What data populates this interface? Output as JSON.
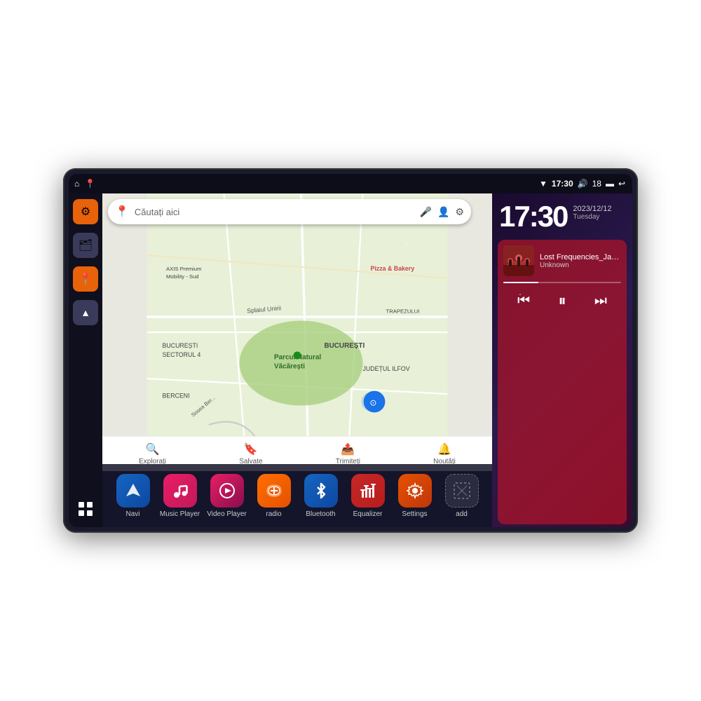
{
  "device": {
    "status_bar": {
      "wifi_icon": "▼",
      "time": "17:30",
      "volume_icon": "🔊",
      "battery_level": "18",
      "battery_icon": "🔋",
      "back_icon": "↩"
    },
    "sidebar": {
      "items": [
        {
          "id": "settings",
          "icon": "⚙",
          "label": "Settings",
          "color": "orange"
        },
        {
          "id": "files",
          "icon": "🗂",
          "label": "Files",
          "color": "gray"
        },
        {
          "id": "maps",
          "icon": "📍",
          "label": "Maps",
          "color": "orange"
        },
        {
          "id": "navigation",
          "icon": "▲",
          "label": "Navigation",
          "color": "gray"
        },
        {
          "id": "grid",
          "icon": "⋮⋮⋮",
          "label": "Grid",
          "color": "gray"
        }
      ]
    },
    "map": {
      "search_placeholder": "Căutați aici",
      "bottom_nav": [
        {
          "icon": "🔍",
          "label": "Explorați"
        },
        {
          "icon": "🔖",
          "label": "Salvate"
        },
        {
          "icon": "📤",
          "label": "Trimiteți"
        },
        {
          "icon": "🔔",
          "label": "Noutăți"
        }
      ],
      "places": [
        "AXIS Premium Mobility - Sud",
        "Parcul Natural Văcărești",
        "Pizza & Bakery",
        "BUCUREȘTI SECTORUL 4",
        "BERCENI",
        "BUCUREȘTI",
        "JUDEȚUL ILFOV",
        "TRAPEZULUI"
      ]
    },
    "clock": {
      "time": "17:30",
      "date": "2023/12/12",
      "day": "Tuesday"
    },
    "music": {
      "track_title": "Lost Frequencies_Janie...",
      "artist": "Unknown",
      "controls": {
        "prev": "⏮",
        "play_pause": "⏸",
        "next": "⏭"
      }
    },
    "apps": [
      {
        "id": "navi",
        "icon": "▲",
        "label": "Navi",
        "color_class": "icon-navi"
      },
      {
        "id": "music-player",
        "icon": "♪",
        "label": "Music Player",
        "color_class": "icon-music"
      },
      {
        "id": "video-player",
        "icon": "▶",
        "label": "Video Player",
        "color_class": "icon-video"
      },
      {
        "id": "radio",
        "icon": "📻",
        "label": "radio",
        "color_class": "icon-radio"
      },
      {
        "id": "bluetooth",
        "icon": "⚡",
        "label": "Bluetooth",
        "color_class": "icon-bluetooth"
      },
      {
        "id": "equalizer",
        "icon": "🎛",
        "label": "Equalizer",
        "color_class": "icon-equalizer"
      },
      {
        "id": "settings",
        "icon": "⚙",
        "label": "Settings",
        "color_class": "icon-settings"
      },
      {
        "id": "add",
        "icon": "+",
        "label": "add",
        "color_class": "icon-add"
      }
    ]
  }
}
